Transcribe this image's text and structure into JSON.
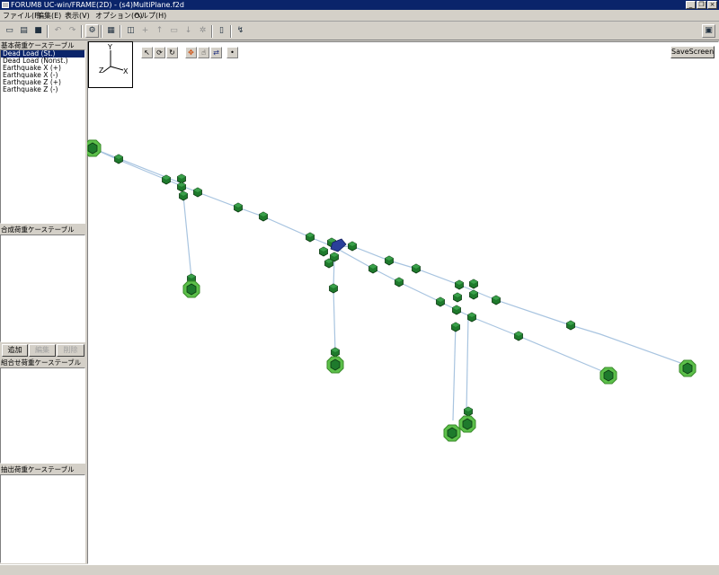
{
  "window": {
    "title": "FORUM8  UC-win/FRAME(2D) - (s4)MultiPlane.f2d"
  },
  "menu": [
    {
      "label": "ファイル(F)"
    },
    {
      "label": "編集(E)"
    },
    {
      "label": "表示(V)"
    },
    {
      "label": "オプション(O)"
    },
    {
      "label": "ヘルプ(H)"
    }
  ],
  "panels": {
    "basic_cases": {
      "header": "基本荷重ケーステーブル",
      "items": [
        {
          "label": "Dead Load (St.)",
          "selected": true
        },
        {
          "label": "Dead Load (Nonst.)",
          "selected": false
        },
        {
          "label": "Earthquake X (+)",
          "selected": false
        },
        {
          "label": "Earthquake X (-)",
          "selected": false
        },
        {
          "label": "Earthquake Z (+)",
          "selected": false
        },
        {
          "label": "Earthquake Z (-)",
          "selected": false
        }
      ]
    },
    "composite_cases": {
      "header": "合成荷重ケーステーブル",
      "buttons": {
        "add": "追加",
        "edit": "編集",
        "delete": "削除"
      }
    },
    "combination_cases": {
      "header": "組合せ荷重ケーステーブル"
    },
    "extract_cases": {
      "header": "抽出荷重ケーステーブル"
    }
  },
  "view": {
    "save_button": "SaveScreen",
    "axes": {
      "y": "Y",
      "x": "X",
      "z": "Z"
    }
  },
  "colors": {
    "title_bar": "#0a246a",
    "node_fill": "#1e7a2c",
    "support_fill": "#5cc04a",
    "member_line": "#a8c4e0",
    "selected_node": "#2a3f9a"
  }
}
